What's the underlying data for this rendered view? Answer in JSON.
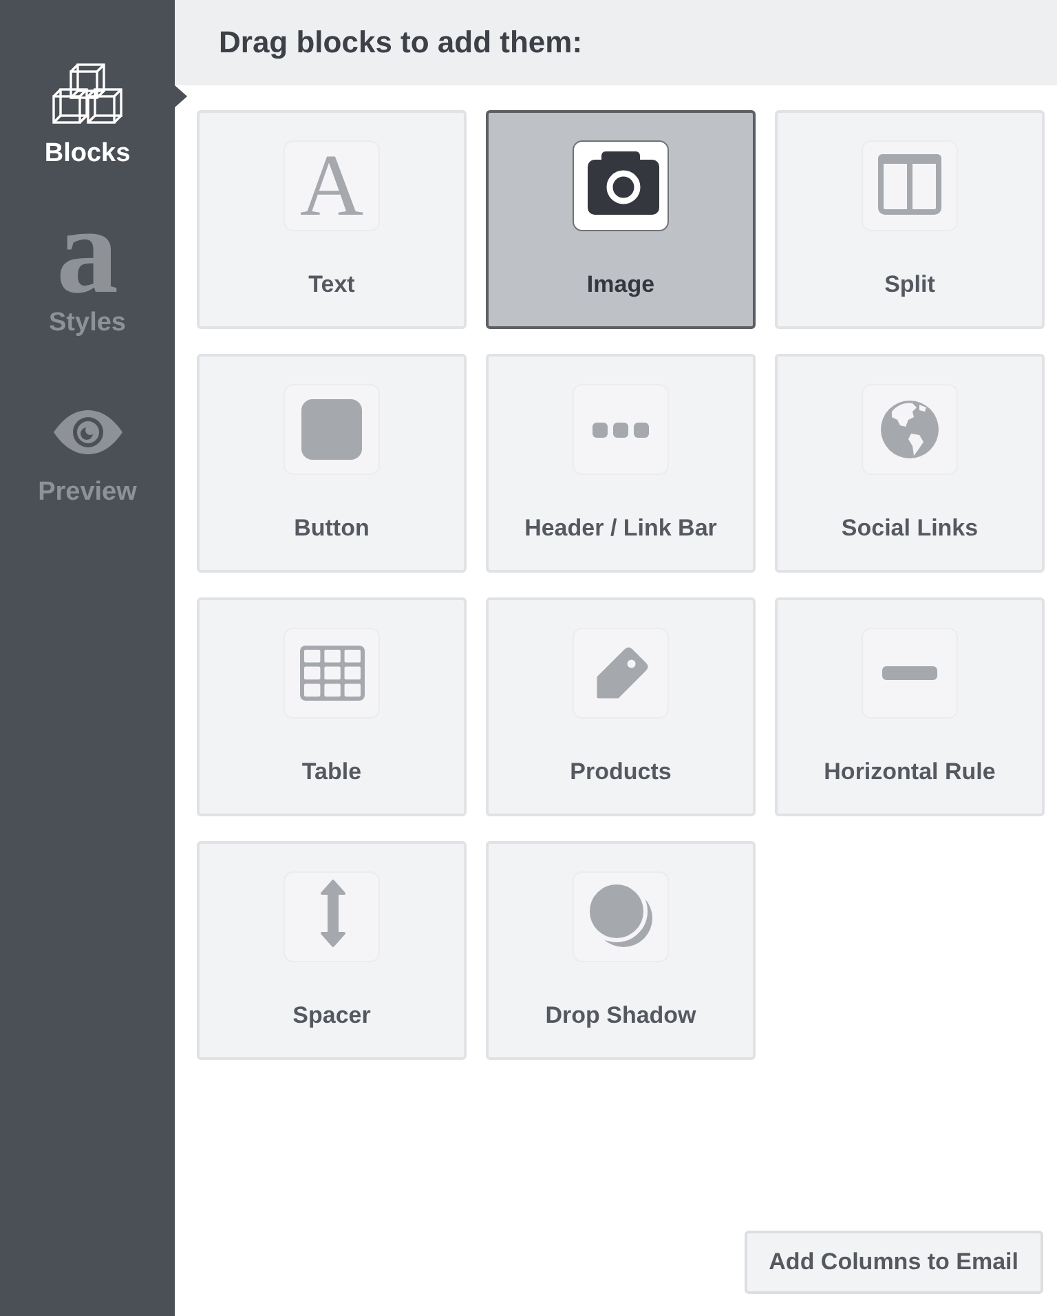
{
  "sidebar": {
    "items": [
      {
        "kind": "blocks",
        "label": "Blocks",
        "selected": true
      },
      {
        "kind": "styles",
        "glyph": "a",
        "label": "Styles",
        "selected": false
      },
      {
        "kind": "preview",
        "label": "Preview",
        "selected": false
      }
    ]
  },
  "header": {
    "title": "Drag blocks to add them:"
  },
  "blocks": [
    {
      "kind": "text",
      "glyph": "A",
      "label": "Text",
      "selected": false
    },
    {
      "kind": "image",
      "label": "Image",
      "selected": true
    },
    {
      "kind": "split",
      "label": "Split",
      "selected": false
    },
    {
      "kind": "button",
      "label": "Button",
      "selected": false
    },
    {
      "kind": "link_bar",
      "label": "Header / Link Bar",
      "selected": false
    },
    {
      "kind": "social",
      "label": "Social Links",
      "selected": false
    },
    {
      "kind": "table",
      "label": "Table",
      "selected": false
    },
    {
      "kind": "products",
      "label": "Products",
      "selected": false
    },
    {
      "kind": "rule",
      "label": "Horizontal Rule",
      "selected": false
    },
    {
      "kind": "spacer",
      "label": "Spacer",
      "selected": false
    },
    {
      "kind": "shadow",
      "label": "Drop Shadow",
      "selected": false
    }
  ],
  "add_columns_button": {
    "label": "Add Columns to Email"
  }
}
